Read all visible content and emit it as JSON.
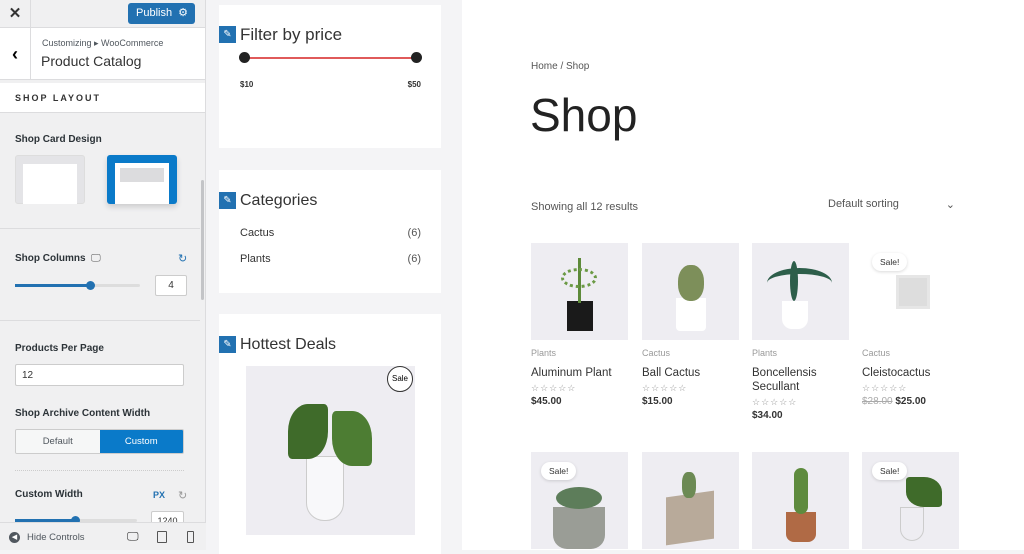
{
  "sidebar": {
    "close": "✕",
    "publish": "Publish",
    "gear": "⚙",
    "back": "‹",
    "breadcrumb": "Customizing ▸ WooCommerce",
    "title": "Product Catalog",
    "section": "SHOP LAYOUT",
    "card_design": "Shop Card Design",
    "columns_label": "Shop Columns",
    "columns_value": "4",
    "columns_fraction": 0.6,
    "per_page_label": "Products Per Page",
    "per_page_value": "12",
    "content_width_label": "Shop Archive Content Width",
    "width_options": [
      "Default",
      "Custom"
    ],
    "width_selected": "Custom",
    "custom_width_label": "Custom Width",
    "unit": "PX",
    "custom_width_value": "1240",
    "hide_controls": "Hide Controls"
  },
  "widgets": {
    "price": {
      "title": "Filter by price",
      "min": "$10",
      "max": "$50"
    },
    "categories": {
      "title": "Categories",
      "items": [
        {
          "name": "Cactus",
          "count": "(6)"
        },
        {
          "name": "Plants",
          "count": "(6)"
        }
      ]
    },
    "deals": {
      "title": "Hottest Deals",
      "badge": "Sale"
    }
  },
  "shop": {
    "breadcrumb": "Home / Shop",
    "title": "Shop",
    "results": "Showing all 12 results",
    "sorting": "Default sorting",
    "products": [
      {
        "category": "Plants",
        "name": "Aluminum Plant",
        "price": "$45.00"
      },
      {
        "category": "Cactus",
        "name": "Ball Cactus",
        "price": "$15.00"
      },
      {
        "category": "Plants",
        "name": "Boncellensis Secullant",
        "price": "$34.00"
      },
      {
        "category": "Cactus",
        "name": "Cleistocactus",
        "old_price": "$28.00",
        "price": "$25.00",
        "badge": "Sale!"
      }
    ],
    "row2_badges": [
      "Sale!",
      "Sale!"
    ],
    "stars": "☆☆☆☆☆"
  },
  "colors": {
    "accent": "#2271b1",
    "price_bar": "#e05a5a"
  }
}
